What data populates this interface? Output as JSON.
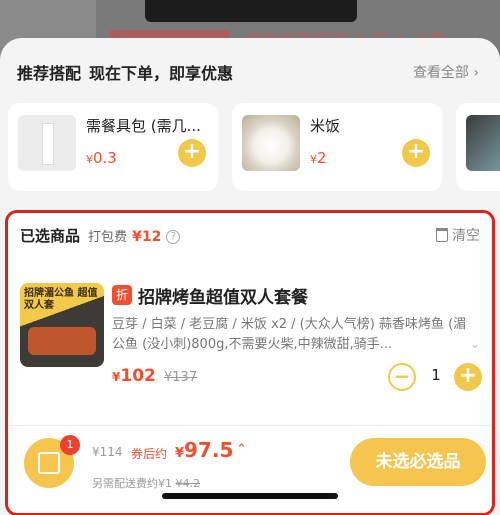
{
  "background": {
    "title": "烤鱼欢聚超值 2 至 4 人餐"
  },
  "recommend": {
    "title": "推荐搭配",
    "subtitle": "现在下单，即享优惠",
    "more_label": "查看全部",
    "items": [
      {
        "name": "需餐具包 (需几...",
        "currency": "¥",
        "price": "0.3",
        "icon": "utensil-pack"
      },
      {
        "name": "米饭",
        "currency": "¥",
        "price": "2",
        "icon": "rice"
      }
    ]
  },
  "selected": {
    "title": "已选商品",
    "pack_fee_label": "打包费",
    "pack_fee": "¥12",
    "clear_label": "清空",
    "item": {
      "tag": "折",
      "name": "招牌烤鱼超值双人套餐",
      "image_text": "招牌湄公鱼 超值双人套",
      "desc": "豆芽 / 白菜 / 老豆腐 / 米饭 x2 / (大众人气榜) 蒜香味烤鱼 (湄公鱼 (没小刺)800g,不需要火柴,中辣微甜,骑手...",
      "currency": "¥",
      "price": "102",
      "original_price": "¥137",
      "quantity": "1"
    }
  },
  "cart": {
    "badge": "1",
    "original_total": "¥114",
    "after_coupon_label": "券后约",
    "currency": "¥",
    "total": "97.5",
    "delivery_note": "另需配送费约¥1",
    "delivery_strike": "¥4.2",
    "checkout_label": "未选必选品"
  },
  "colors": {
    "accent": "#f5c54e",
    "price": "#f0502f",
    "highlight_border": "#d9241c"
  }
}
